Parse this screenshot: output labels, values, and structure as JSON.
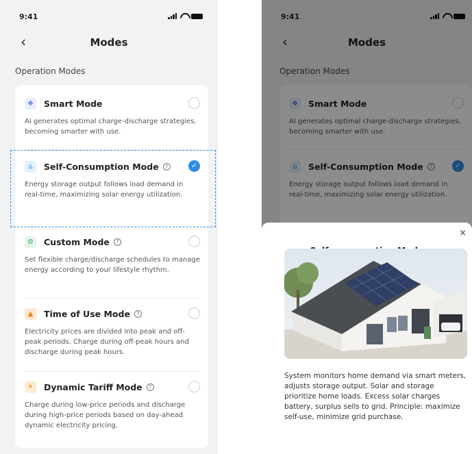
{
  "status": {
    "time": "9:41"
  },
  "header": {
    "back_icon": "chevron-left-icon",
    "title": "Modes"
  },
  "section_label": "Operation Modes",
  "modes": [
    {
      "title": "Smart Mode",
      "has_help": false,
      "selected": false,
      "icon": "smart-mode-icon",
      "icon_color": "#e8eefb",
      "icon_fg": "#4a6fd8",
      "description": "AI generates optimal charge-discharge strategies, becoming smarter with use."
    },
    {
      "title": "Self-Consumption Mode",
      "has_help": true,
      "selected": true,
      "icon": "home-icon",
      "icon_color": "#e3f1fa",
      "icon_fg": "#2d8ee6",
      "description": "Energy storage output follows load demand in real-time, maximizing solar energy utilization."
    },
    {
      "title": "Custom Mode",
      "has_help": true,
      "selected": false,
      "icon": "gear-icon",
      "icon_color": "#e4f5ea",
      "icon_fg": "#3aa864",
      "description": "Set flexible charge/discharge schedules to manage energy according to your lifestyle rhythm."
    },
    {
      "title": "Time of Use Mode",
      "has_help": true,
      "selected": false,
      "icon": "clock-icon",
      "icon_color": "#fbe7cf",
      "icon_fg": "#e88a18",
      "description": "Electricity prices are divided into peak and off-peak periods. Charge during off-peak hours and discharge during peak hours."
    },
    {
      "title": "Dynamic Tariff Mode",
      "has_help": true,
      "selected": false,
      "icon": "tariff-icon",
      "icon_color": "#fdeccf",
      "icon_fg": "#f0a020",
      "description": "Charge during low-price periods and discharge during high-price periods based on day-ahead dynamic electricity pricing."
    }
  ],
  "help_glyph": "?",
  "check_glyph": "✓",
  "sheet": {
    "close_glyph": "×",
    "title": "Self-consumption Mode",
    "image_alt": "solar-house-illustration",
    "body": "System monitors home demand via smart meters, adjusts storage output. Solar and storage prioritize home loads. Excess solar charges battery, surplus sells to grid. Principle: maximize self-use, minimize grid purchase."
  },
  "colors": {
    "accent": "#2d8ee6",
    "background": "#f2f2f4",
    "card": "#ffffff"
  }
}
